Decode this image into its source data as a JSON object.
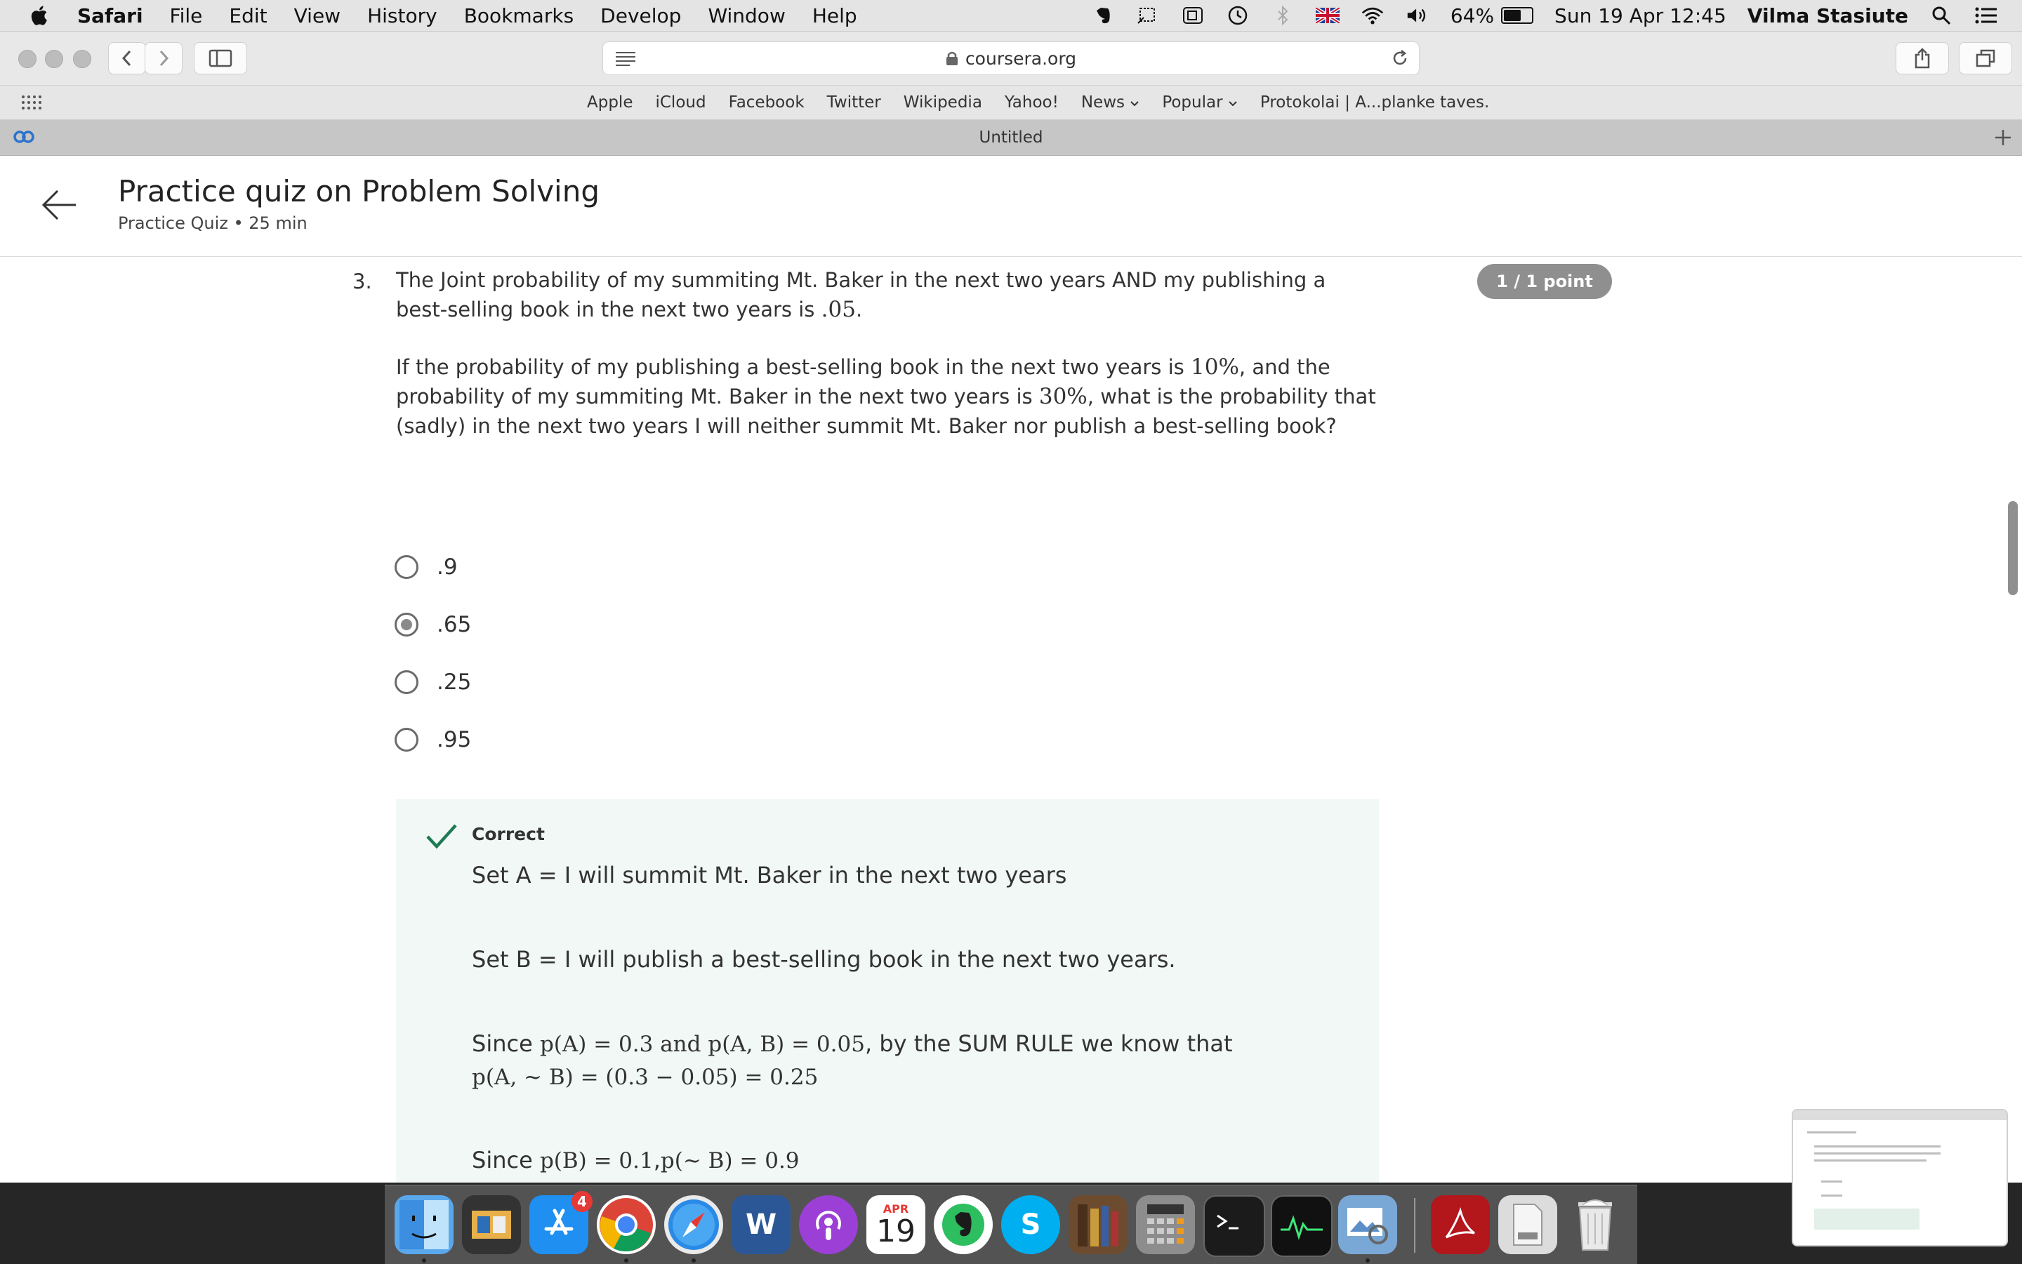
{
  "menubar": {
    "app": "Safari",
    "items": [
      "File",
      "Edit",
      "View",
      "History",
      "Bookmarks",
      "Develop",
      "Window",
      "Help"
    ],
    "battery": "64%",
    "datetime": "Sun 19 Apr  12:45",
    "user": "Vilma Stasiute"
  },
  "toolbar": {
    "url": "coursera.org"
  },
  "bookmarks": [
    "Apple",
    "iCloud",
    "Facebook",
    "Twitter",
    "Wikipedia",
    "Yahoo!",
    "News",
    "Popular",
    "Protokolai | A...planke taves."
  ],
  "tab": {
    "title": "Untitled"
  },
  "header": {
    "title": "Practice quiz on Problem Solving",
    "subtitle": "Practice Quiz • 25 min"
  },
  "question": {
    "number": "3.",
    "points": "1 / 1 point",
    "p1_a": "The Joint probability of my summiting Mt. Baker in the next two years AND my publishing a best-selling book in the next two years is ",
    "p1_math": ".05",
    "p1_b": ".",
    "p2_a": "If the probability of my publishing a best-selling book in the next two years is ",
    "p2_m1": "10%",
    "p2_b": ", and the probability of my summiting Mt. Baker in the next two years is ",
    "p2_m2": "30%",
    "p2_c": ", what is the probability that (sadly) in the next two years I will neither summit Mt. Baker nor publish a best-selling book?",
    "options": [
      ".9",
      ".65",
      ".25",
      ".95"
    ],
    "selected_index": 1
  },
  "feedback": {
    "label": "Correct",
    "line1": "Set A = I will summit Mt. Baker in the next two years",
    "line2": "Set B = I will publish a best-selling book in the next two years.",
    "line3_a": "Since ",
    "line3_m1": "p(A) = 0.3",
    "line3_and": " and ",
    "line3_m2": "p(A, B) = 0.05",
    "line3_b": ", by the SUM RULE we know that",
    "line3_m3": "p(A, ~ B) = (0.3 − 0.05) = 0.25",
    "line4_a": "Since ",
    "line4_m1": "p(B) = 0.1",
    "line4_sep": ",",
    "line4_m2": "p(~ B) = 0.9"
  },
  "dock": {
    "calendar_month": "APR",
    "calendar_day": "19",
    "appstore_badge": "4"
  }
}
